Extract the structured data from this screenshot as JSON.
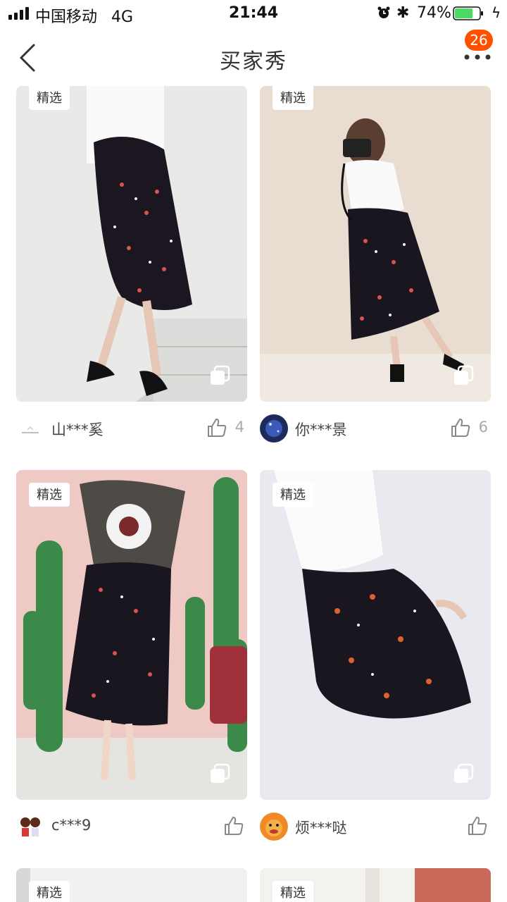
{
  "status_bar": {
    "carrier": "中国移动",
    "network": "4G",
    "time": "21:44",
    "battery_percent": "74%",
    "battery_level": 0.74,
    "battery_color": "#4cd964"
  },
  "nav": {
    "title": "买家秀",
    "badge_count": "26",
    "badge_color": "#ff5000",
    "back_icon": "chevron-left-icon",
    "more_icon": "more-dots-icon"
  },
  "posts": [
    {
      "tag": "精选",
      "user": "山***奚",
      "likes": "4"
    },
    {
      "tag": "精选",
      "user": "你***景",
      "likes": "6"
    },
    {
      "tag": "精选",
      "user": "c***9",
      "likes": ""
    },
    {
      "tag": "精选",
      "user": "烦***哒",
      "likes": ""
    },
    {
      "tag": "精选"
    },
    {
      "tag": "精选"
    }
  ]
}
